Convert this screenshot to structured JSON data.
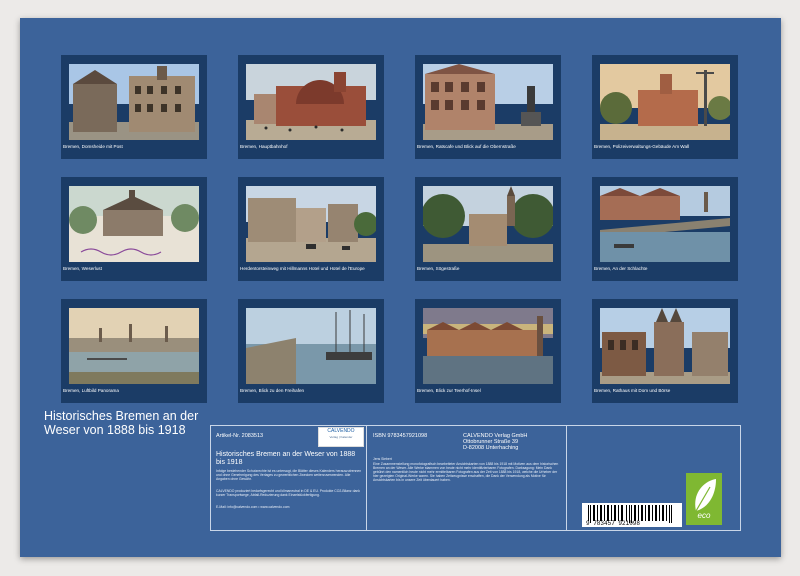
{
  "thumbnails": [
    {
      "caption": "Bremen, Domsheide mit Post"
    },
    {
      "caption": "Bremen, Hauptbahnhof"
    },
    {
      "caption": "Bremen, Ratscafe und Blick auf die Obernstraße"
    },
    {
      "caption": "Bremen, Polizeiverwaltungs-Gebäude Am Wall"
    },
    {
      "caption": "Bremen, Weserlust"
    },
    {
      "caption": "Herdentorsteinweg mit Hillmanns Hotel und Hotel de l'Europe"
    },
    {
      "caption": "Bremen, Sögestraße"
    },
    {
      "caption": "Bremen, An der Schlachte"
    },
    {
      "caption": "Bremen, Luftbild Panorama"
    },
    {
      "caption": "Bremen, Blick zu den Freihafen"
    },
    {
      "caption": "Bremen, Blick zur Teerhof-Insel"
    },
    {
      "caption": "Bremen, Rathaus mit Dom und Börse"
    }
  ],
  "back": {
    "title": "Historisches Bremen an der Weser von 1888 bis 1918",
    "article_label": "Artikel-Nr. 2083513",
    "logo_brand": "CALVENDO",
    "logo_tagline": "Verlag | Kalender",
    "product_title": "Historisches Bremen an der Weser von 1888 bis 1918",
    "legal_text": "Infolge bestehender Schutzrechte ist es untersagt, die Blätter dieses Kalenders herauszutrennen und ohne Genehmigung des Verlages zu gewerblichen Zwecken weiterzuverwenden. Alle Angaben ohne Gewähr.",
    "production_text": "CALVENDO produziert bedarfsgerecht und klimaneutral in DE & EU. Produkte CO2-Bilanz dank kurzer Transportwege, Abfall-Reduzierung dank Einzelstückfertigung.",
    "contact": "E-Mail: info@calvendo.com • www.calvendo.com",
    "isbn": "ISBN 9783457921098",
    "publisher_lines": [
      "CALVENDO Verlag GmbH",
      "Ottobrunner Straße 39",
      "D-82008 Unterhaching"
    ],
    "author": "Jens Siebert",
    "description": "Eine Zusammenstellung monofotografisch bearbeiteter Ansichtskarten von 1888 bis 1918 mit Motiven aus dem historischen Bremen an der Weser. Alle Werke stammen von heute nicht mehr identifizierbaren Fotografen. Darksagung: Mein Dank gebührt den namentlich heute nicht mehr ermittelbaren Fotografen aus der Zeit von 1888 bis 1918, welche die Urheber der hier gezeigten Original-Werke waren. Sie haben Zeitzeugnisse erschaffen, die Dank der Verwendung als Motive für Ansichtskarten bis in unsere Zeit überdauert haben.",
    "barcode_number": "9 783457 921098",
    "eco_label": "eco"
  },
  "colors": {
    "background": "#3c639a",
    "card": "#1b3c66",
    "eco": "#7fb832"
  }
}
